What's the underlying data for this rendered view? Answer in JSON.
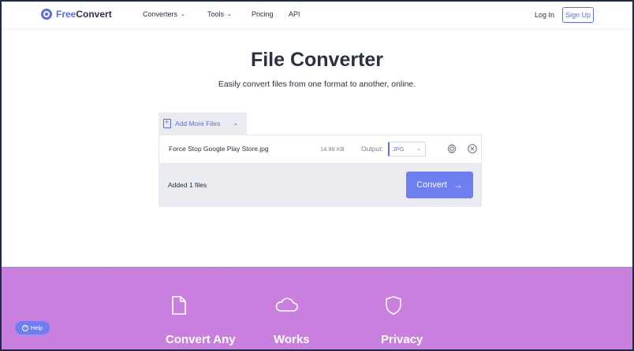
{
  "header": {
    "logo_free": "Free",
    "logo_convert": "Convert",
    "nav": [
      {
        "label": "Converters",
        "has_dropdown": true
      },
      {
        "label": "Tools",
        "has_dropdown": true
      },
      {
        "label": "Pricing",
        "has_dropdown": false
      },
      {
        "label": "API",
        "has_dropdown": false
      }
    ],
    "login_label": "Log In",
    "signup_label": "Sign Up"
  },
  "hero": {
    "title": "File Converter",
    "subtitle": "Easily convert files from one format to another, online."
  },
  "uploader": {
    "add_more_label": "Add More Files",
    "file": {
      "name": "Force Stop Google Play Store.jpg",
      "size": "14.98 KB",
      "output_label": "Output:",
      "output_format": "JPG"
    },
    "added_text": "Added 1 files",
    "convert_label": "Convert"
  },
  "features": [
    {
      "title": "Convert Any",
      "icon": "file-icon"
    },
    {
      "title": "Works",
      "icon": "cloud-icon"
    },
    {
      "title": "Privacy",
      "icon": "shield-icon"
    }
  ],
  "help_label": "Help",
  "colors": {
    "accent": "#5b6ee1",
    "button": "#6d7ef0",
    "band": "#c97fde",
    "panel": "#e9ebf0"
  }
}
